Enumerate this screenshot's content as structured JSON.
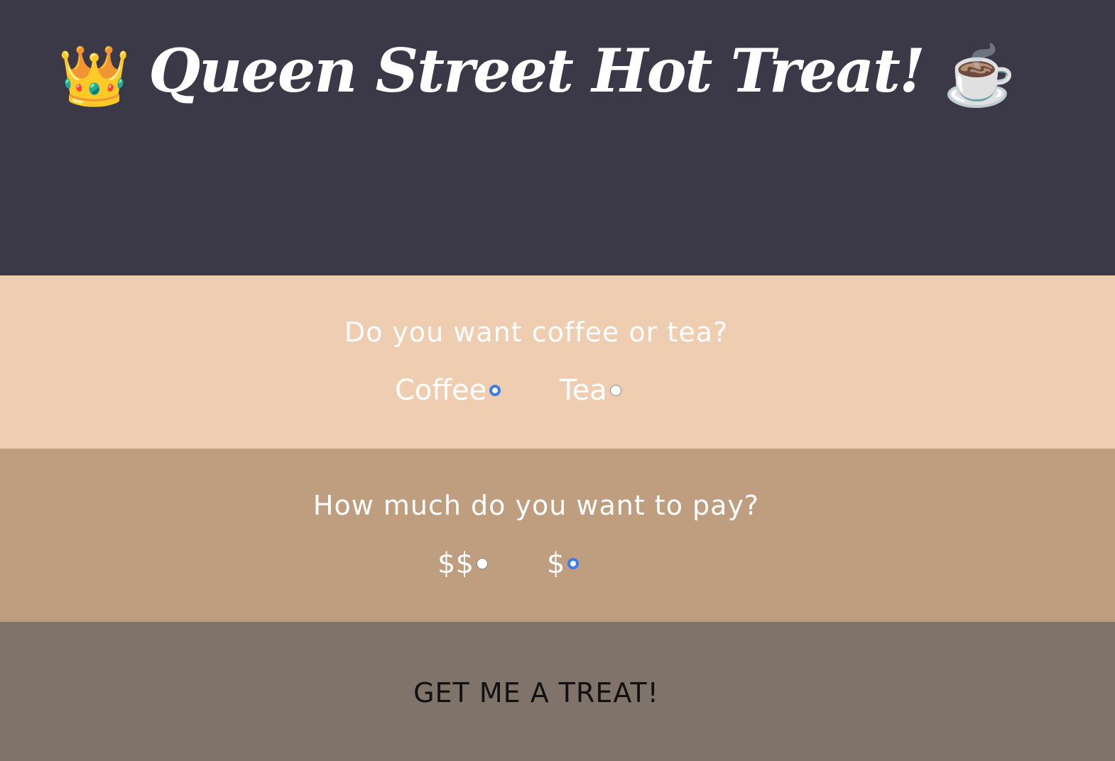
{
  "header": {
    "title": "Queen Street Hot Treat!",
    "left_icon": "crown-icon",
    "right_icon": "hot-beverage-icon"
  },
  "drink_question": {
    "question": "Do you want coffee or tea?",
    "options": [
      {
        "label": "Coffee",
        "selected": true
      },
      {
        "label": "Tea",
        "selected": false
      }
    ]
  },
  "price_question": {
    "question": "How much do you want to pay?",
    "options": [
      {
        "label": "$$",
        "selected": false
      },
      {
        "label": "$",
        "selected": true
      }
    ]
  },
  "submit": {
    "label": "GET ME A TREAT!"
  },
  "colors": {
    "header_bg": "#3b3947",
    "drink_band_bg": "#efcdb1",
    "price_band_bg": "#bf9e80",
    "submit_band_bg": "#7f736a",
    "radio_accent": "#3a7bef"
  }
}
